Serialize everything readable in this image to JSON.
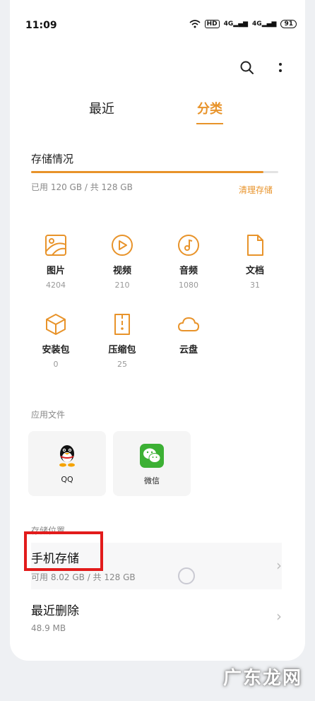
{
  "status_bar": {
    "time": "11:09",
    "hd": "HD",
    "signal1": "4G",
    "signal2": "4G",
    "battery": "91"
  },
  "tabs": [
    {
      "label": "最近"
    },
    {
      "label": "分类",
      "active": true
    }
  ],
  "storage": {
    "title": "存储情况",
    "used_text": "已用 120 GB / 共 128 GB",
    "used_fraction": 0.94,
    "clean_label": "清理存储"
  },
  "categories": [
    {
      "name": "图片",
      "count": "4204",
      "icon": "image-icon"
    },
    {
      "name": "视频",
      "count": "210",
      "icon": "video-icon"
    },
    {
      "name": "音频",
      "count": "1080",
      "icon": "music-icon"
    },
    {
      "name": "文档",
      "count": "31",
      "icon": "document-icon"
    },
    {
      "name": "安装包",
      "count": "0",
      "icon": "package-icon"
    },
    {
      "name": "压缩包",
      "count": "25",
      "icon": "archive-icon"
    },
    {
      "name": "云盘",
      "count": "",
      "icon": "cloud-icon"
    }
  ],
  "app_files": {
    "label": "应用文件",
    "apps": [
      {
        "name": "QQ",
        "icon": "qq-icon"
      },
      {
        "name": "微信",
        "icon": "wechat-icon"
      }
    ]
  },
  "locations": {
    "label": "存储位置",
    "items": [
      {
        "title": "手机存储",
        "sub": "可用 8.02 GB / 共 128 GB"
      },
      {
        "title": "最近删除",
        "sub": "48.9 MB"
      }
    ]
  },
  "watermark": "广东龙网",
  "colors": {
    "accent": "#e8932a",
    "highlight": "#e21b1b",
    "wechat": "#3cb034"
  }
}
